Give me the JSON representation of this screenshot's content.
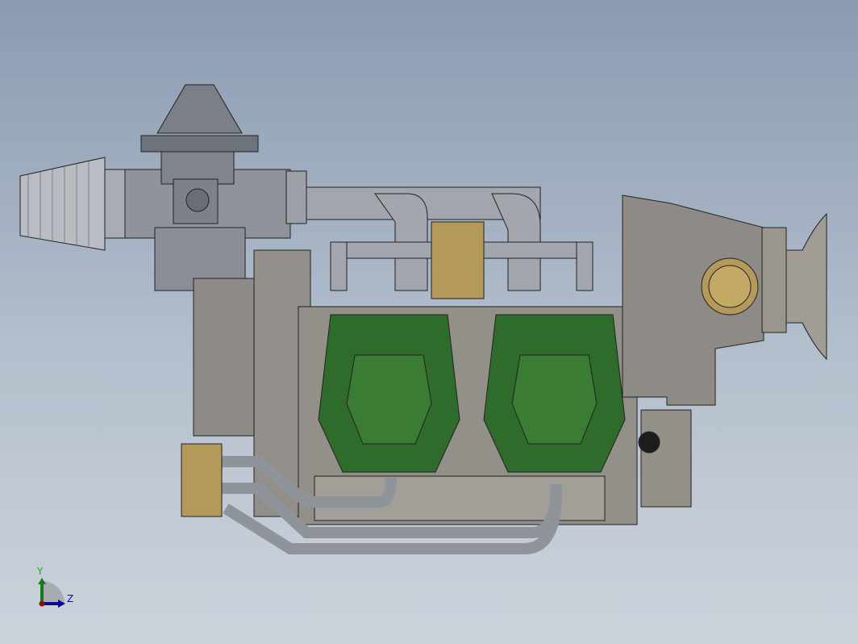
{
  "viewport": {
    "model": "engine-assembly",
    "colors": {
      "metal": "#8e8b87",
      "pipe": "#a3a6ad",
      "cover": "#2f6b2a",
      "brass": "#b49a5a",
      "dark": "#5f636b"
    }
  },
  "triad": {
    "y_label": "Y",
    "z_label": "Z",
    "y_color": "#00c000",
    "z_color": "#0000ff"
  }
}
